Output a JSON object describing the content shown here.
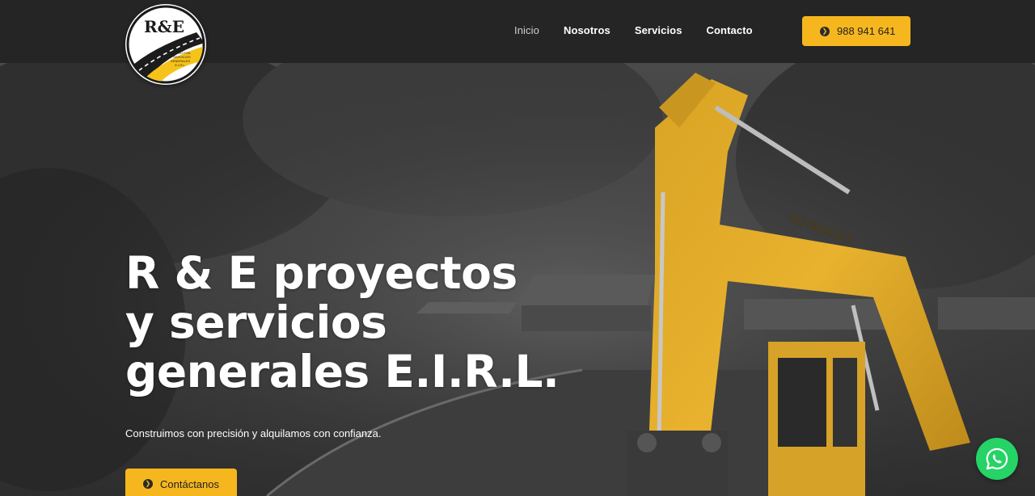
{
  "header": {
    "logo_text": "R&E",
    "logo_subtext": "PROYECTOS Y SERVICIOS GENERALES E.I.R.L.",
    "nav": [
      {
        "label": "Inicio",
        "active": true
      },
      {
        "label": "Nosotros",
        "active": false
      },
      {
        "label": "Servicios",
        "active": false
      },
      {
        "label": "Contacto",
        "active": false
      }
    ],
    "phone_label": "988 941 641",
    "phone_icon": "chevron-right-circle-icon"
  },
  "hero": {
    "title_lines": [
      "R & E proyectos",
      "y servicios",
      "generales E.I.R.L."
    ],
    "subtitle": "Construimos con precisión y alquilamos con confianza.",
    "cta_label": "Contáctanos",
    "cta_icon": "chevron-right-circle-icon",
    "background_image": "excavator-construction-site",
    "machine_text": "EXCAVATOR"
  },
  "floating": {
    "whatsapp_icon": "whatsapp-icon"
  },
  "colors": {
    "accent": "#f6b71e",
    "header_bg": "#252525",
    "whatsapp": "#25d366"
  }
}
